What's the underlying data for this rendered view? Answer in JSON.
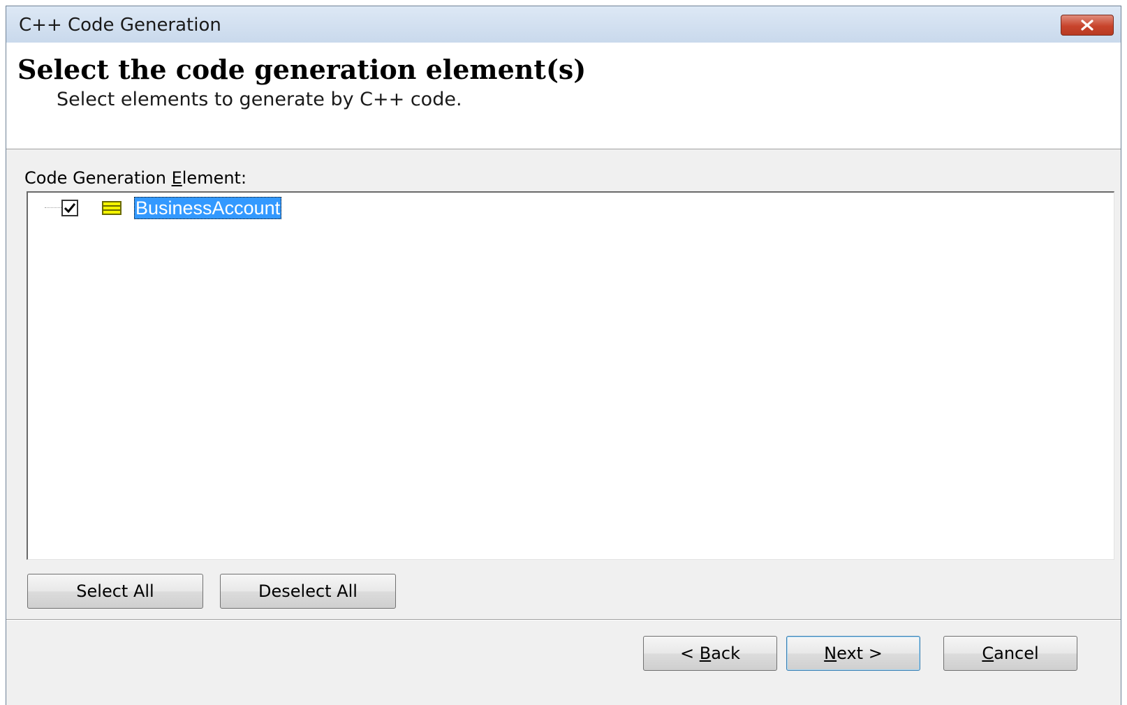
{
  "window": {
    "title": "C++ Code Generation",
    "close_label": "✕"
  },
  "header": {
    "title": "Select the code generation element(s)",
    "subtitle": "Select elements to generate by C++ code."
  },
  "element_list": {
    "label_pre": "Code Generation ",
    "label_access": "E",
    "label_post": "lement:",
    "items": [
      {
        "label": "BusinessAccount",
        "checked": true,
        "selected": true,
        "icon": "class-icon"
      }
    ]
  },
  "selection_buttons": {
    "select_all": "Select All",
    "deselect_all": "Deselect All"
  },
  "nav_buttons": {
    "back_pre": "< ",
    "back_access": "B",
    "back_post": "ack",
    "next_access": "N",
    "next_post": "ext >",
    "cancel_access": "C",
    "cancel_post": "ancel"
  },
  "colors": {
    "selection": "#3399ff",
    "close_button": "#c8442c",
    "class_icon": "#f4f400"
  }
}
